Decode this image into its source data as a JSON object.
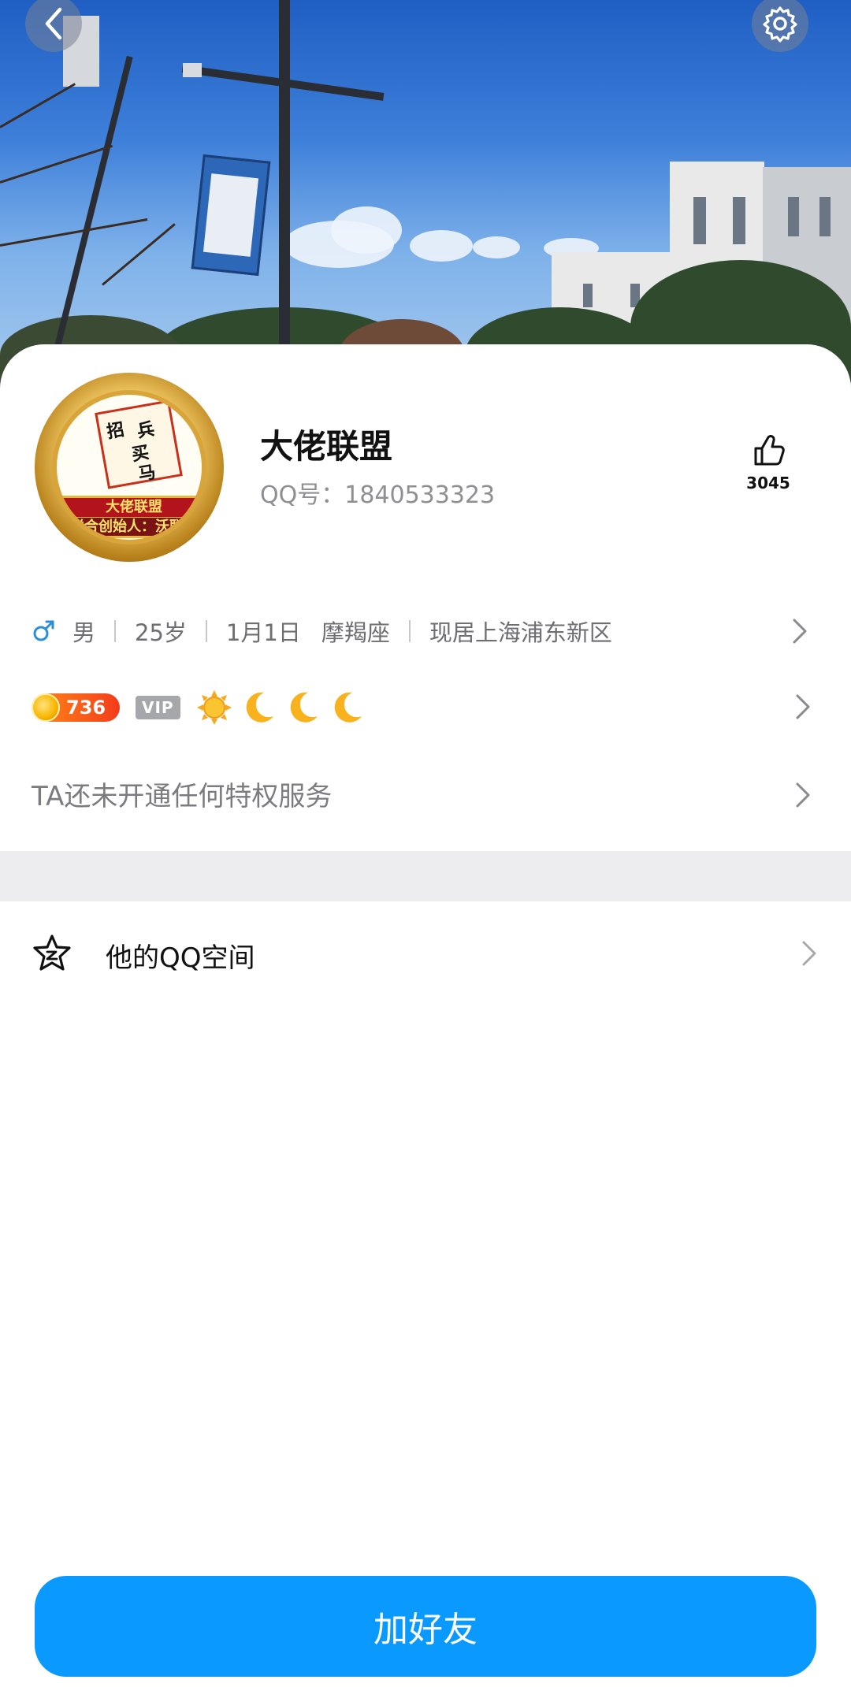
{
  "header": {
    "back_icon": "chevron-left-icon",
    "settings_icon": "gear-icon"
  },
  "profile": {
    "nickname": "大佬联盟",
    "qq_label": "QQ号：",
    "qq_number": "1840533323",
    "avatar_text": {
      "flag_chars": [
        "招",
        "兵",
        "买",
        "马"
      ],
      "ribbon_top": "大佬联盟",
      "ribbon_bottom": "联合创始人：沃联盟"
    },
    "likes": {
      "icon": "thumbs-up-icon",
      "count": "3045"
    }
  },
  "info": {
    "gender_icon": "male-icon",
    "gender": "男",
    "age": "25岁",
    "birthday": "1月1日",
    "zodiac": "摩羯座",
    "location": "现居上海浦东新区"
  },
  "badges": {
    "level": "736",
    "vip": "VIP",
    "level_icons": [
      "sun-icon",
      "moon-icon",
      "moon-icon",
      "moon-icon"
    ]
  },
  "privilege_text": "TA还未开通任何特权服务",
  "qzone": {
    "icon": "qzone-star-icon",
    "label": "他的QQ空间"
  },
  "actions": {
    "add_friend": "加好友"
  },
  "colors": {
    "accent": "#0a99ff",
    "male": "#2a8fd6",
    "level_orange": "#f43b1a"
  }
}
